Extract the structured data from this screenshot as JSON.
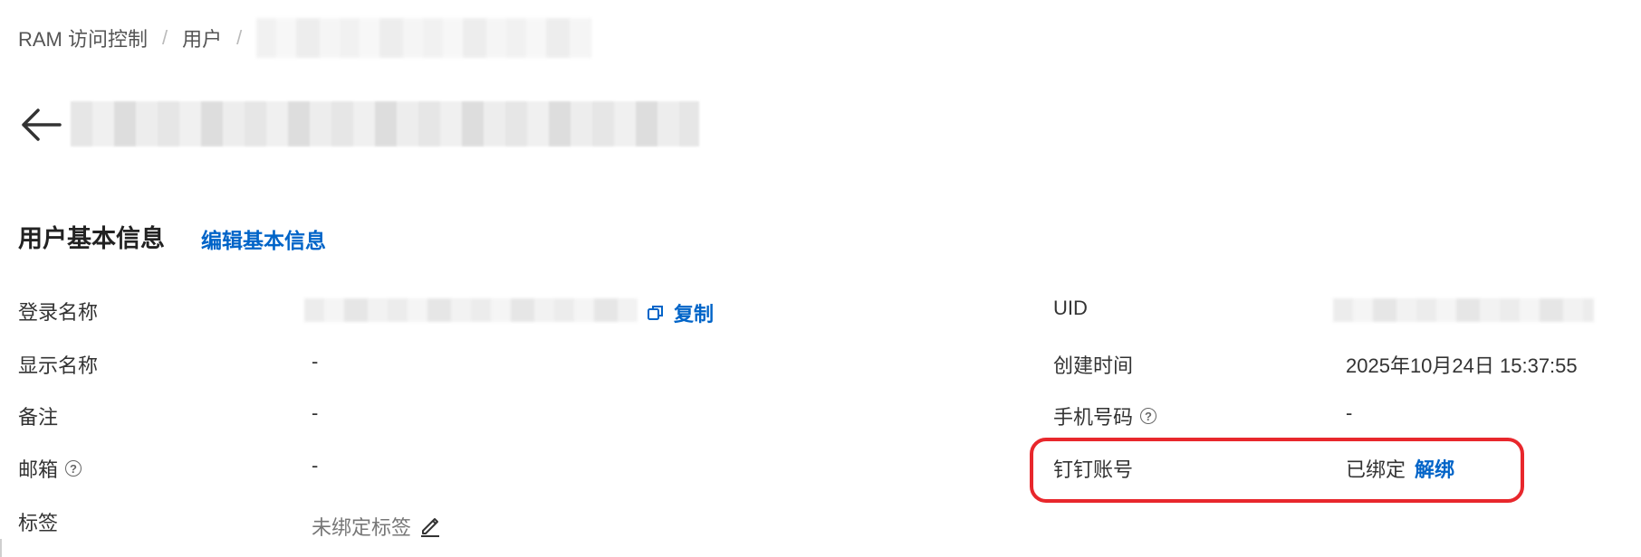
{
  "breadcrumb": {
    "items": [
      "RAM 访问控制",
      "用户"
    ],
    "separator": "/"
  },
  "section": {
    "title": "用户基本信息",
    "edit_label": "编辑基本信息"
  },
  "fields": {
    "login_name": {
      "label": "登录名称",
      "copy_label": "复制"
    },
    "display_name": {
      "label": "显示名称",
      "value": "-"
    },
    "remark": {
      "label": "备注",
      "value": "-"
    },
    "email": {
      "label": "邮箱",
      "value": "-"
    },
    "tags": {
      "label": "标签",
      "value": "未绑定标签"
    },
    "uid": {
      "label": "UID"
    },
    "created_time": {
      "label": "创建时间",
      "value": "2025年10月24日 15:37:55"
    },
    "phone": {
      "label": "手机号码",
      "value": "-"
    },
    "dingtalk": {
      "label": "钉钉账号",
      "status": "已绑定",
      "unbind_label": "解绑"
    }
  },
  "help_icon_glyph": "?",
  "colors": {
    "link": "#0064c8",
    "highlight": "#e8272c",
    "text": "#333333"
  }
}
